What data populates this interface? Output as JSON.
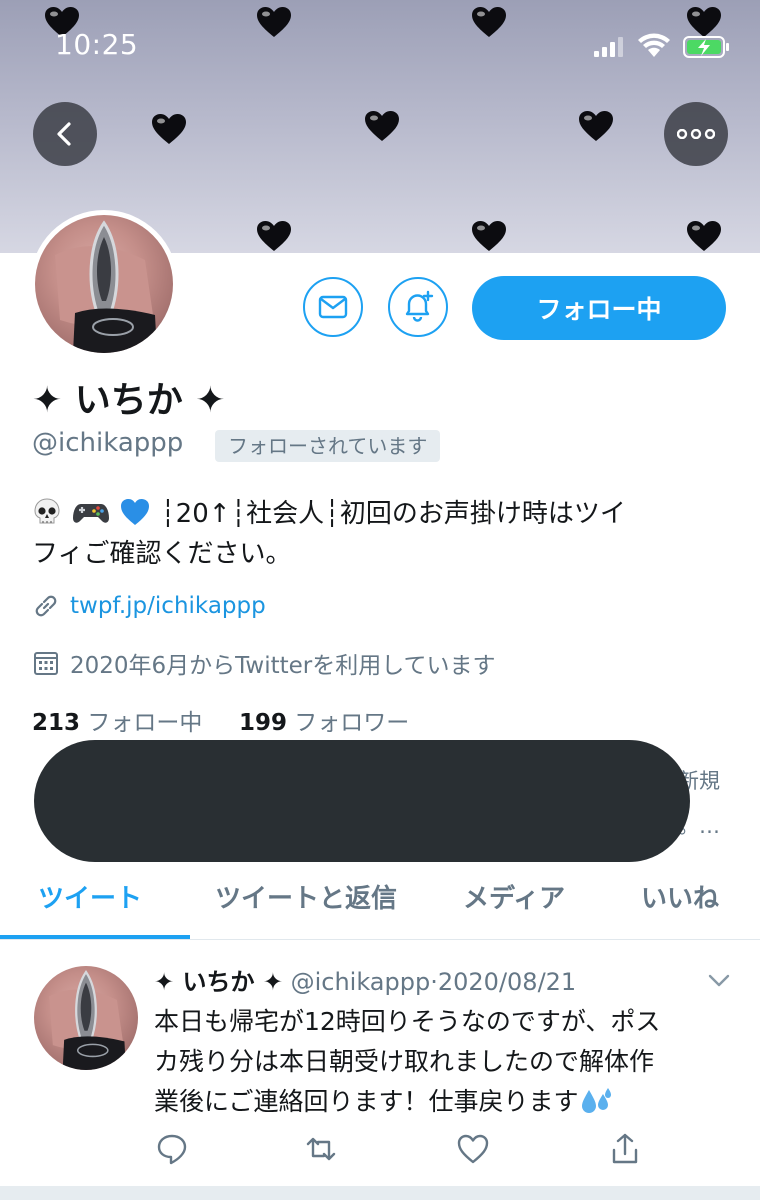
{
  "status_bar": {
    "time": "10:25"
  },
  "profile": {
    "display_name": "✦ いちか ✦",
    "handle": "@ichikappp",
    "follows_you_label": "フォローされています",
    "follow_button_label": "フォロー中",
    "bio_emojis": [
      "skull-emoji",
      "game-controller-emoji",
      "blue-heart-emoji"
    ],
    "bio_text_line1": "┆20↑┆社会人┆初回のお声掛け時はツイ",
    "bio_text_line2": "フィご確認ください。",
    "link": "twpf.jp/ichikappp",
    "joined": "2020年6月からTwitterを利用しています",
    "following_count": "213",
    "following_label": "フォロー中",
    "followers_count": "199",
    "followers_label": "フォロワー",
    "redacted_peek_line1": "新規",
    "redacted_peek_line2": "。…"
  },
  "tabs": [
    {
      "label": "ツイート",
      "active": true
    },
    {
      "label": "ツイートと返信",
      "active": false
    },
    {
      "label": "メディア",
      "active": false
    },
    {
      "label": "いいね",
      "active": false
    }
  ],
  "tweet": {
    "name": "✦ いちか ✦",
    "handle": "@ichikappp",
    "separator": "·",
    "date": "2020/08/21",
    "body_line1": "本日も帰宅が12時回りそうなのですが、ポス",
    "body_line2": "カ残り分は本日朝受け取れましたので解体作",
    "body_line3": "業後にご連絡回ります！仕事戻ります",
    "body_emoji": "sweat-droplets-emoji"
  },
  "colors": {
    "accent": "#1da1f2",
    "link": "#1b95e0",
    "secondary_text": "#657786",
    "redaction": "#292f33"
  }
}
